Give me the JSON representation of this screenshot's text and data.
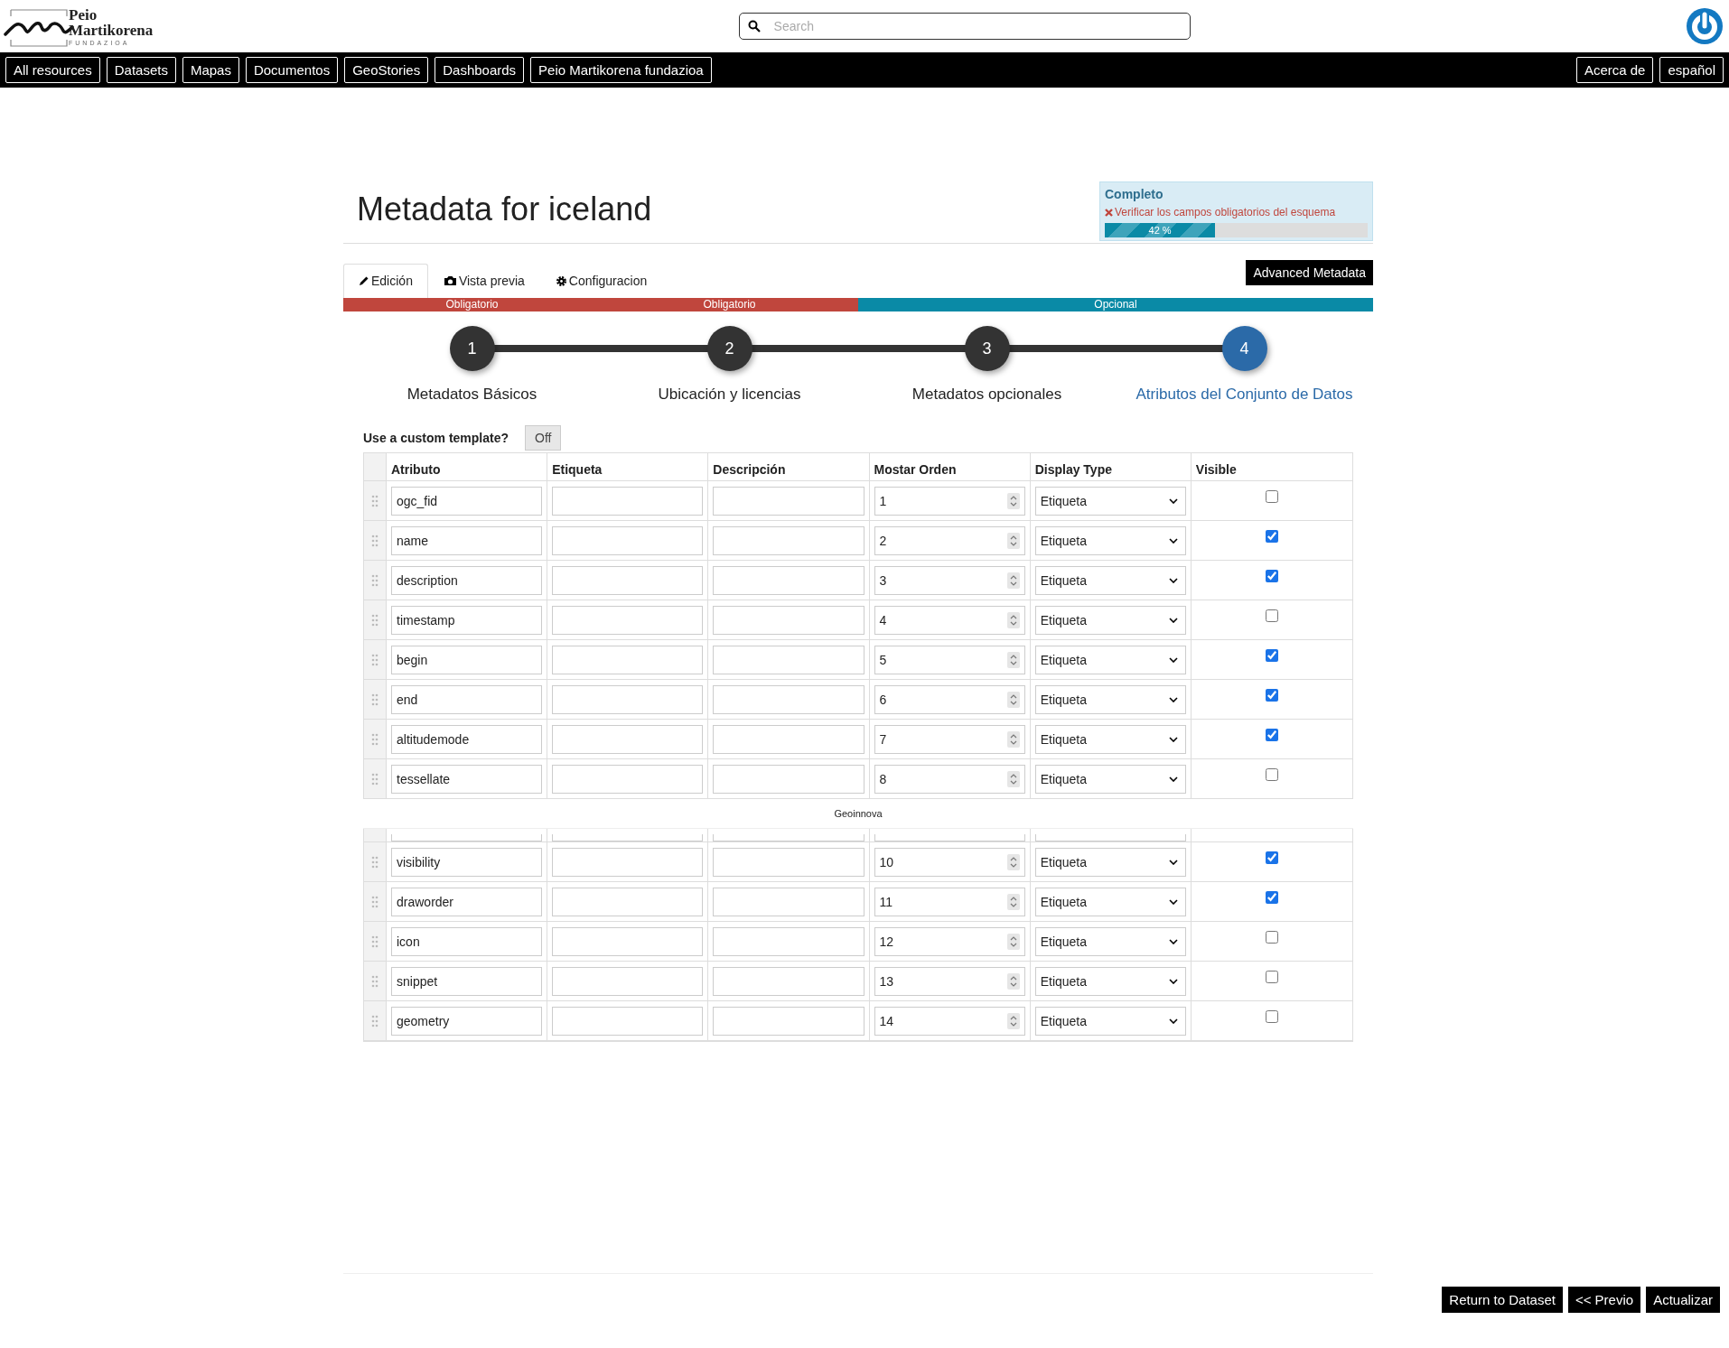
{
  "header": {
    "logo": {
      "line1": "Peio",
      "line2": "Martikorena",
      "line3": "FUNDAZIOA"
    },
    "search": {
      "placeholder": "Search"
    }
  },
  "nav": {
    "left": [
      "All resources",
      "Datasets",
      "Mapas",
      "Documentos",
      "GeoStories",
      "Dashboards",
      "Peio Martikorena fundazioa"
    ],
    "right": [
      "Acerca de",
      "español"
    ]
  },
  "page_title": "Metadata for iceland",
  "completeness": {
    "title": "Completo",
    "warning": "Verificar los campos obligatorios del esquema",
    "level": 0.42,
    "reading": "42 %"
  },
  "tabs": [
    {
      "kind": "pencil",
      "label": "Edición",
      "selected": true
    },
    {
      "kind": "camera",
      "label": "Vista previa",
      "selected": false
    },
    {
      "kind": "gear",
      "label": "Configuracion",
      "selected": false
    }
  ],
  "advanced_button": "Advanced Metadata",
  "sections": [
    {
      "kind": "mandatory",
      "label": "Obligatorio"
    },
    {
      "kind": "mandatory",
      "label": "Obligatorio"
    },
    {
      "kind": "optional",
      "label": "Opcional"
    }
  ],
  "steps": [
    {
      "number": "1",
      "label": "Metadatos Básicos",
      "selected": false
    },
    {
      "number": "2",
      "label": "Ubicación y licencias",
      "selected": false
    },
    {
      "number": "3",
      "label": "Metadatos opcionales",
      "selected": false
    },
    {
      "number": "4",
      "label": "Atributos del Conjunto de Datos",
      "selected": true
    }
  ],
  "custom_template": {
    "label": "Use a custom template?",
    "value": "Off",
    "on": false
  },
  "table": {
    "columns": [
      "Atributo",
      "Etiqueta",
      "Descripción",
      "Mostar Orden",
      "Display Type",
      "Visible"
    ],
    "rows": [
      {
        "attribute": "ogc_fid",
        "order": "1",
        "display_type": "Etiqueta",
        "visible": false
      },
      {
        "attribute": "name",
        "order": "2",
        "display_type": "Etiqueta",
        "visible": true
      },
      {
        "attribute": "description",
        "order": "3",
        "display_type": "Etiqueta",
        "visible": true
      },
      {
        "attribute": "timestamp",
        "order": "4",
        "display_type": "Etiqueta",
        "visible": false
      },
      {
        "attribute": "begin",
        "order": "5",
        "display_type": "Etiqueta",
        "visible": true
      },
      {
        "attribute": "end",
        "order": "6",
        "display_type": "Etiqueta",
        "visible": true
      },
      {
        "attribute": "altitudemode",
        "order": "7",
        "display_type": "Etiqueta",
        "visible": true
      },
      {
        "attribute": "tessellate",
        "order": "8",
        "display_type": "Etiqueta",
        "visible": false
      },
      {
        "kind": "cut"
      },
      {
        "attribute": "visibility",
        "order": "10",
        "display_type": "Etiqueta",
        "visible": true
      },
      {
        "attribute": "draworder",
        "order": "11",
        "display_type": "Etiqueta",
        "visible": true
      },
      {
        "attribute": "icon",
        "order": "12",
        "display_type": "Etiqueta",
        "visible": false
      },
      {
        "attribute": "snippet",
        "order": "13",
        "display_type": "Etiqueta",
        "visible": false
      },
      {
        "attribute": "geometry",
        "order": "14",
        "display_type": "Etiqueta",
        "visible": false
      }
    ]
  },
  "overlay_label": "Geoinnova",
  "footer_buttons": [
    "Return to Dataset",
    "<< Previo",
    "Actualizar"
  ]
}
